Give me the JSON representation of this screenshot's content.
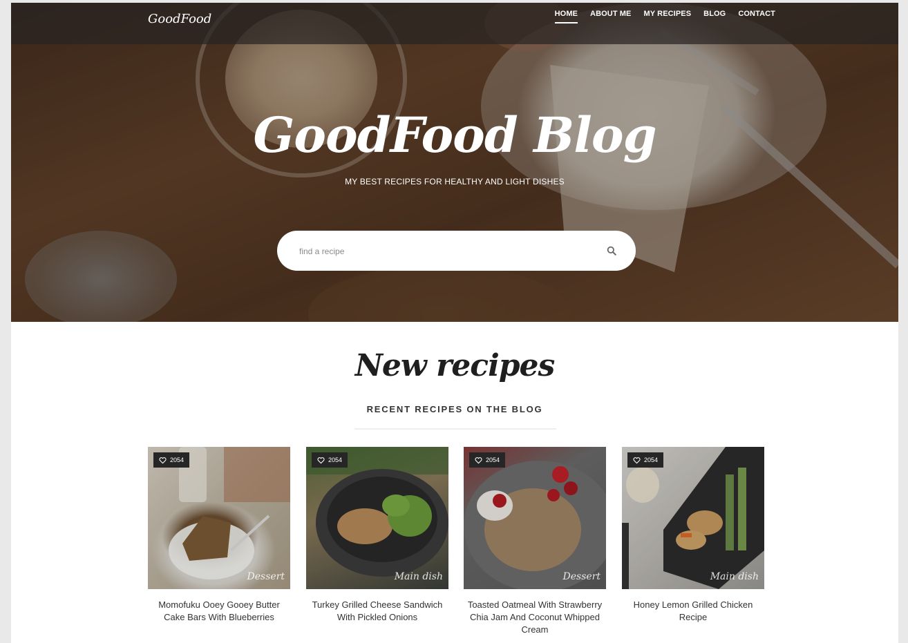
{
  "header": {
    "logo": "GoodFood",
    "nav": [
      "HOME",
      "ABOUT ME",
      "MY RECIPES",
      "BLOG",
      "CONTACT"
    ],
    "active_nav": "HOME"
  },
  "hero": {
    "title": "GoodFood Blog",
    "subtitle": "MY BEST RECIPES FOR HEALTHY AND LIGHT DISHES",
    "search": {
      "placeholder": "find a recipe",
      "value": ""
    }
  },
  "section": {
    "title": "New recipes",
    "subtitle": "RECENT RECIPES ON THE BLOG"
  },
  "recipes": [
    {
      "likes": "2054",
      "category": "Dessert",
      "title": "Momofuku Ooey Gooey Butter Cake Bars With Blueberries"
    },
    {
      "likes": "2054",
      "category": "Main dish",
      "title": "Turkey Grilled Cheese Sandwich With Pickled Onions"
    },
    {
      "likes": "2054",
      "category": "Dessert",
      "title": "Toasted Oatmeal With Strawberry Chia Jam And Coconut Whipped Cream"
    },
    {
      "likes": "2054",
      "category": "Main dish",
      "title": "Honey Lemon Grilled Chicken Recipe"
    }
  ],
  "colors": {
    "topbar": "#282422",
    "badge": "#262626",
    "text_dark": "#1f1f1f"
  }
}
